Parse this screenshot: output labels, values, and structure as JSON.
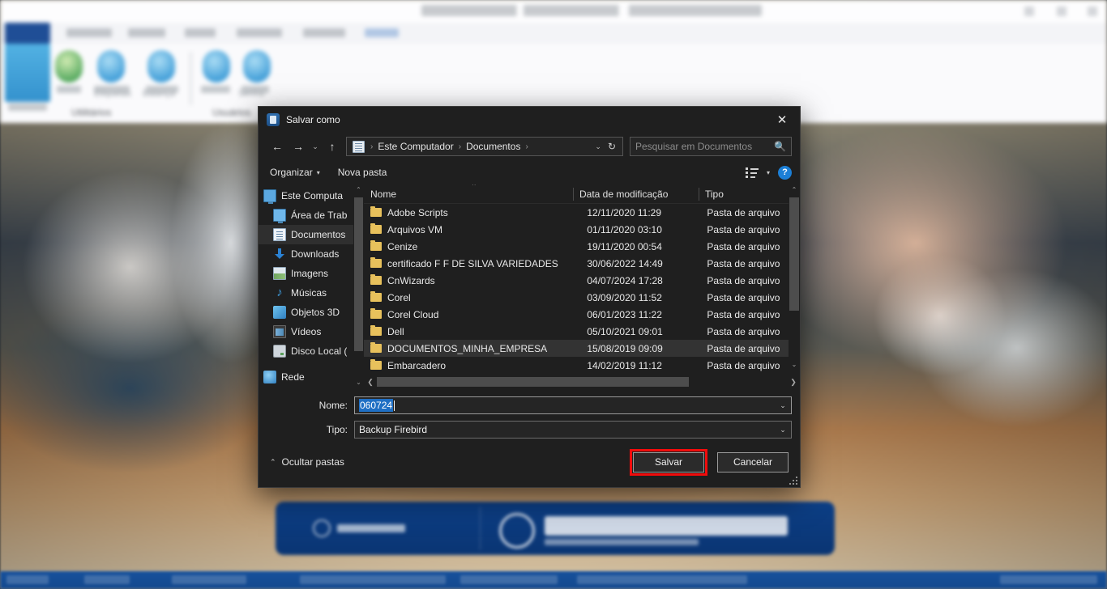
{
  "background_app": {
    "group_labels": [
      "Utilitários",
      "Usuários"
    ],
    "icon_labels": [
      "Etiquetas",
      "Balança",
      "Senha"
    ]
  },
  "dialog": {
    "title": "Salvar como",
    "close_label": "✕",
    "nav": {
      "back_icon": "←",
      "forward_icon": "→",
      "recent_icon": "⌄",
      "up_icon": "↑",
      "breadcrumbs": [
        "Este Computador",
        "Documentos"
      ],
      "separator": "›",
      "dropdown_icon": "⌄",
      "refresh_icon": "↻"
    },
    "search": {
      "placeholder": "Pesquisar em Documentos",
      "icon": "search-icon"
    },
    "toolbar": {
      "organize_label": "Organizar",
      "organize_caret": "▾",
      "new_folder_label": "Nova pasta",
      "view_caret": "▾",
      "help_label": "?"
    },
    "tree": {
      "items": [
        {
          "label": "Este Computa",
          "icon": "monitor-icon",
          "indent": false,
          "selected": false
        },
        {
          "label": "Área de Trab",
          "icon": "desktop-icon",
          "indent": true,
          "selected": false
        },
        {
          "label": "Documentos",
          "icon": "documents-icon",
          "indent": true,
          "selected": true
        },
        {
          "label": "Downloads",
          "icon": "download-icon",
          "indent": true,
          "selected": false
        },
        {
          "label": "Imagens",
          "icon": "pictures-icon",
          "indent": true,
          "selected": false
        },
        {
          "label": "Músicas",
          "icon": "music-icon",
          "indent": true,
          "selected": false
        },
        {
          "label": "Objetos 3D",
          "icon": "objects3d-icon",
          "indent": true,
          "selected": false
        },
        {
          "label": "Vídeos",
          "icon": "videos-icon",
          "indent": true,
          "selected": false
        },
        {
          "label": "Disco Local (",
          "icon": "disk-icon",
          "indent": true,
          "selected": false
        },
        {
          "label": "Rede",
          "icon": "network-icon",
          "indent": false,
          "selected": false
        }
      ],
      "scroll_up_icon": "⌃",
      "scroll_down_icon": "⌄"
    },
    "file_list": {
      "columns": [
        "Nome",
        "Data de modificação",
        "Tipo"
      ],
      "sort_indicator": "⌃",
      "rows": [
        {
          "name": "Adobe Scripts",
          "date": "12/11/2020 11:29",
          "type": "Pasta de arquivo",
          "selected": false
        },
        {
          "name": "Arquivos VM",
          "date": "01/11/2020 03:10",
          "type": "Pasta de arquivo",
          "selected": false
        },
        {
          "name": "Cenize",
          "date": "19/11/2020 00:54",
          "type": "Pasta de arquivo",
          "selected": false
        },
        {
          "name": "certificado F F DE SILVA VARIEDADES",
          "date": "30/06/2022 14:49",
          "type": "Pasta de arquivo",
          "selected": false
        },
        {
          "name": "CnWizards",
          "date": "04/07/2024 17:28",
          "type": "Pasta de arquivo",
          "selected": false
        },
        {
          "name": "Corel",
          "date": "03/09/2020 11:52",
          "type": "Pasta de arquivo",
          "selected": false
        },
        {
          "name": "Corel Cloud",
          "date": "06/01/2023 11:22",
          "type": "Pasta de arquivo",
          "selected": false
        },
        {
          "name": "Dell",
          "date": "05/10/2021 09:01",
          "type": "Pasta de arquivo",
          "selected": false
        },
        {
          "name": "DOCUMENTOS_MINHA_EMPRESA",
          "date": "15/08/2019 09:09",
          "type": "Pasta de arquivo",
          "selected": true
        },
        {
          "name": "Embarcadero",
          "date": "14/02/2019 11:12",
          "type": "Pasta de arquivo",
          "selected": false
        }
      ],
      "hscroll_left_icon": "❮",
      "hscroll_right_icon": "❯",
      "vscroll_up_icon": "⌃",
      "vscroll_down_icon": "⌄"
    },
    "form": {
      "name_label": "Nome:",
      "name_value": "060724",
      "type_label": "Tipo:",
      "type_value": "Backup Firebird",
      "dropdown_icon": "⌄"
    },
    "footer": {
      "hide_folders_label": "Ocultar pastas",
      "hide_folders_caret": "⌃",
      "save_label": "Salvar",
      "cancel_label": "Cancelar"
    }
  },
  "annotation": {
    "highlight_color": "#f10c0c",
    "target": "Salvar"
  },
  "colors": {
    "dialog_bg": "#1f1f1f",
    "selection_blue": "#1f6fc4",
    "folder_yellow": "#e8c15c",
    "help_blue": "#1c7fd6"
  }
}
